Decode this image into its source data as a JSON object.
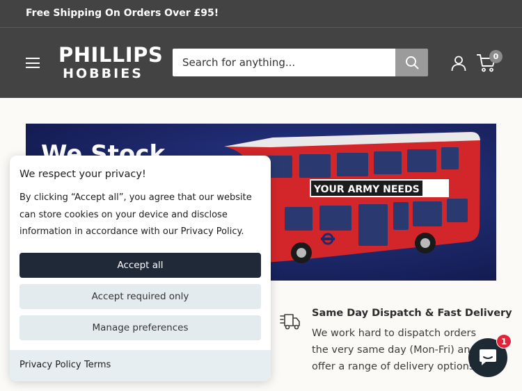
{
  "announcement": {
    "text": "Free Shipping On Orders Over £95!"
  },
  "header": {
    "logo_line1": "PHILLIPS",
    "logo_line2": "HOBBIES",
    "search_placeholder": "Search for anything...",
    "cart_count": "0"
  },
  "hero": {
    "headline": "We Stock",
    "bus_banner": "YOUR ARMY NEEDS YOU"
  },
  "feature": {
    "title": "Same Day Dispatch & Fast Delivery",
    "body": "We work hard to dispatch orders the very same day (Mon-Fri) and offer a range of delivery options."
  },
  "cookie": {
    "title": "We respect your privacy!",
    "body": "By clicking “Accept all”, you agree that our website can store cookies on your device and disclose information in accordance with our Privacy Policy.",
    "accept_all": "Accept all",
    "accept_required": "Accept required only",
    "manage": "Manage preferences",
    "privacy_link": "Privacy Policy",
    "terms_link": "Terms"
  },
  "chat": {
    "badge": "1"
  },
  "colors": {
    "header_bg": "#434343",
    "page_bg": "#fbfaf7",
    "hero_bg": "#1e2a6c",
    "bus_red": "#d2262a",
    "primary_button": "#1f2937",
    "secondary_button": "#e4ebee",
    "badge_red": "#e0263b"
  }
}
